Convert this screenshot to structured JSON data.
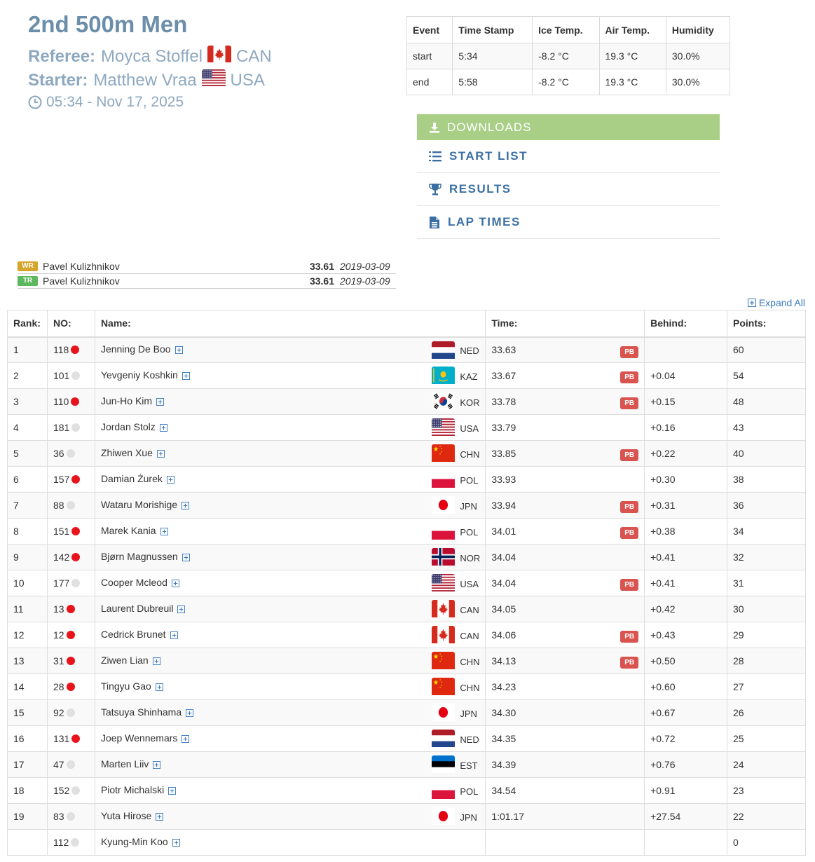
{
  "header": {
    "title": "2nd 500m Men",
    "referee_label": "Referee:",
    "referee_name": "Moyca Stoffel",
    "referee_country": "CAN",
    "starter_label": "Starter:",
    "starter_name": "Matthew Vraa",
    "starter_country": "USA",
    "datetime": "05:34 - Nov 17, 2025"
  },
  "conditions": {
    "headers": [
      "Event",
      "Time Stamp",
      "Ice Temp.",
      "Air Temp.",
      "Humidity"
    ],
    "rows": [
      [
        "start",
        "5:34",
        "-8.2 °C",
        "19.3 °C",
        "30.0%"
      ],
      [
        "end",
        "5:58",
        "-8.2 °C",
        "19.3 °C",
        "30.0%"
      ]
    ]
  },
  "downloads": {
    "title": "DOWNLOADS",
    "items": [
      "START LIST",
      "RESULTS",
      "LAP TIMES"
    ]
  },
  "records": [
    {
      "badge": "WR",
      "badge_color": "#d4a52a",
      "name": "Pavel Kulizhnikov",
      "time": "33.61",
      "date": "2019-03-09"
    },
    {
      "badge": "TR",
      "badge_color": "#5cb85c",
      "name": "Pavel Kulizhnikov",
      "time": "33.61",
      "date": "2019-03-09"
    }
  ],
  "expand_all": "Expand All",
  "results": {
    "headers": [
      "Rank:",
      "NO:",
      "Name:",
      "Time:",
      "Behind:",
      "Points:"
    ],
    "pb_label": "PB",
    "rows": [
      {
        "rank": "1",
        "no": "118",
        "dot": "red",
        "name": "Jenning De Boo",
        "nat": "NED",
        "time": "33.63",
        "pb": true,
        "behind": "",
        "points": "60"
      },
      {
        "rank": "2",
        "no": "101",
        "dot": "grey",
        "name": "Yevgeniy Koshkin",
        "nat": "KAZ",
        "time": "33.67",
        "pb": true,
        "behind": "+0.04",
        "points": "54"
      },
      {
        "rank": "3",
        "no": "110",
        "dot": "red",
        "name": "Jun-Ho Kim",
        "nat": "KOR",
        "time": "33.78",
        "pb": true,
        "behind": "+0.15",
        "points": "48"
      },
      {
        "rank": "4",
        "no": "181",
        "dot": "grey",
        "name": "Jordan Stolz",
        "nat": "USA",
        "time": "33.79",
        "pb": false,
        "behind": "+0.16",
        "points": "43"
      },
      {
        "rank": "5",
        "no": "36",
        "dot": "grey",
        "name": "Zhiwen Xue",
        "nat": "CHN",
        "time": "33.85",
        "pb": true,
        "behind": "+0.22",
        "points": "40"
      },
      {
        "rank": "6",
        "no": "157",
        "dot": "red",
        "name": "Damian Żurek",
        "nat": "POL",
        "time": "33.93",
        "pb": false,
        "behind": "+0.30",
        "points": "38"
      },
      {
        "rank": "7",
        "no": "88",
        "dot": "grey",
        "name": "Wataru Morishige",
        "nat": "JPN",
        "time": "33.94",
        "pb": true,
        "behind": "+0.31",
        "points": "36"
      },
      {
        "rank": "8",
        "no": "151",
        "dot": "red",
        "name": "Marek Kania",
        "nat": "POL",
        "time": "34.01",
        "pb": true,
        "behind": "+0.38",
        "points": "34"
      },
      {
        "rank": "9",
        "no": "142",
        "dot": "red",
        "name": "Bjørn Magnussen",
        "nat": "NOR",
        "time": "34.04",
        "pb": false,
        "behind": "+0.41",
        "points": "32"
      },
      {
        "rank": "10",
        "no": "177",
        "dot": "grey",
        "name": "Cooper Mcleod",
        "nat": "USA",
        "time": "34.04",
        "pb": true,
        "behind": "+0.41",
        "points": "31"
      },
      {
        "rank": "11",
        "no": "13",
        "dot": "red",
        "name": "Laurent Dubreuil",
        "nat": "CAN",
        "time": "34.05",
        "pb": false,
        "behind": "+0.42",
        "points": "30"
      },
      {
        "rank": "12",
        "no": "12",
        "dot": "red",
        "name": "Cedrick Brunet",
        "nat": "CAN",
        "time": "34.06",
        "pb": true,
        "behind": "+0.43",
        "points": "29"
      },
      {
        "rank": "13",
        "no": "31",
        "dot": "red",
        "name": "Ziwen Lian",
        "nat": "CHN",
        "time": "34.13",
        "pb": true,
        "behind": "+0.50",
        "points": "28"
      },
      {
        "rank": "14",
        "no": "28",
        "dot": "red",
        "name": "Tingyu Gao",
        "nat": "CHN",
        "time": "34.23",
        "pb": false,
        "behind": "+0.60",
        "points": "27"
      },
      {
        "rank": "15",
        "no": "92",
        "dot": "grey",
        "name": "Tatsuya Shinhama",
        "nat": "JPN",
        "time": "34.30",
        "pb": false,
        "behind": "+0.67",
        "points": "26"
      },
      {
        "rank": "16",
        "no": "131",
        "dot": "red",
        "name": "Joep Wennemars",
        "nat": "NED",
        "time": "34.35",
        "pb": false,
        "behind": "+0.72",
        "points": "25"
      },
      {
        "rank": "17",
        "no": "47",
        "dot": "grey",
        "name": "Marten Liiv",
        "nat": "EST",
        "time": "34.39",
        "pb": false,
        "behind": "+0.76",
        "points": "24"
      },
      {
        "rank": "18",
        "no": "152",
        "dot": "grey",
        "name": "Piotr Michalski",
        "nat": "POL",
        "time": "34.54",
        "pb": false,
        "behind": "+0.91",
        "points": "23"
      },
      {
        "rank": "19",
        "no": "83",
        "dot": "grey",
        "name": "Yuta Hirose",
        "nat": "JPN",
        "time": "1:01.17",
        "pb": false,
        "behind": "+27.54",
        "points": "22"
      },
      {
        "rank": "",
        "no": "112",
        "dot": "grey",
        "name": "Kyung-Min Koo",
        "nat": "",
        "time": "",
        "pb": false,
        "behind": "",
        "points": "0"
      }
    ]
  }
}
